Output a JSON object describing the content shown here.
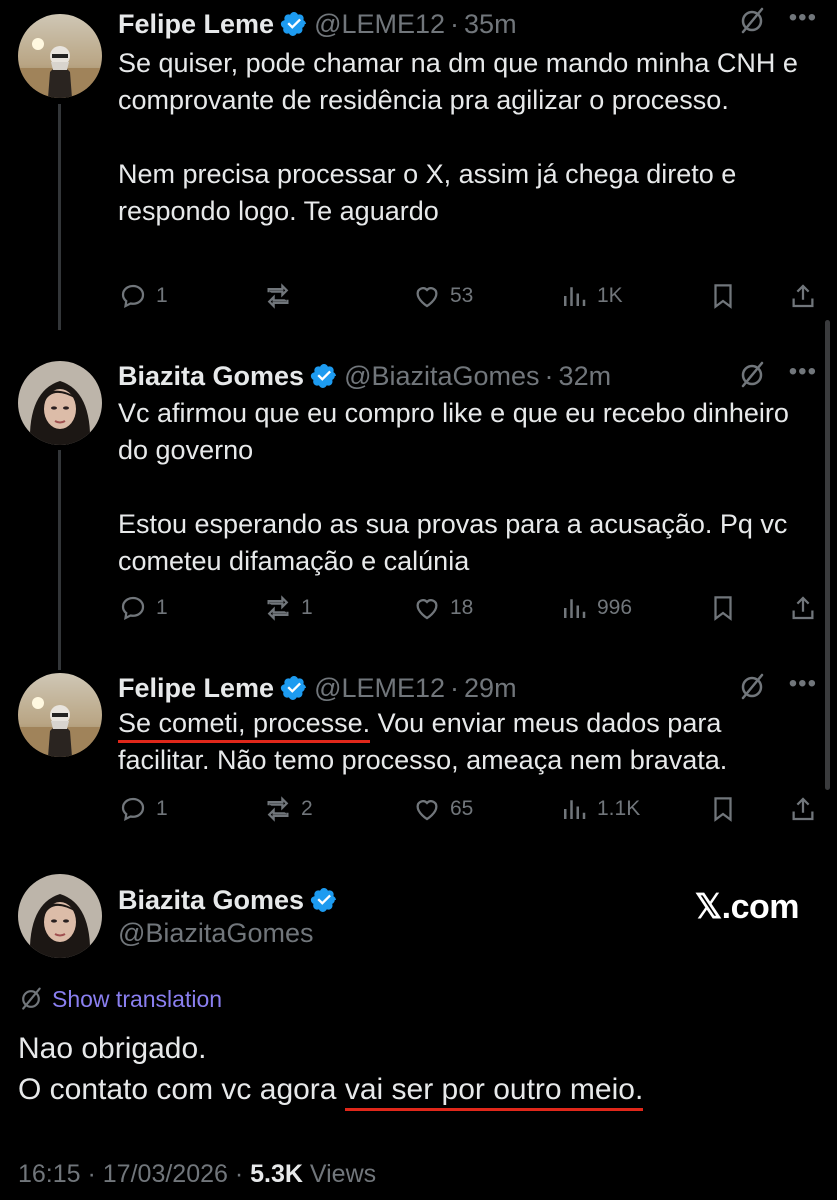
{
  "thread": [
    {
      "name": "Felipe Leme",
      "handle": "@LEME12",
      "time": "35m",
      "paragraphs": [
        "Se quiser, pode chamar na dm que mando minha CNH e comprovante de residência pra agilizar o processo.",
        "Nem precisa processar o X, assim já chega direto e respondo logo. Te aguardo"
      ],
      "replies": "1",
      "reposts": "",
      "likes": "53",
      "views": "1K"
    },
    {
      "name": "Biazita Gomes",
      "handle": "@BiazitaGomes",
      "time": "32m",
      "paragraphs": [
        "Vc afirmou que eu compro like e que eu recebo dinheiro do governo",
        "Estou esperando as sua provas para a acusação. Pq vc cometeu difamação e calúnia"
      ],
      "replies": "1",
      "reposts": "1",
      "likes": "18",
      "views": "996"
    },
    {
      "name": "Felipe Leme",
      "handle": "@LEME12",
      "time": "29m",
      "highlight": "Se cometi, processe.",
      "rest": " Vou enviar meus dados para facilitar. Não temo processo, ameaça nem bravata.",
      "replies": "1",
      "reposts": "2",
      "likes": "65",
      "views": "1.1K"
    }
  ],
  "main": {
    "name": "Biazita Gomes",
    "handle": "@BiazitaGomes",
    "watermark": "𝕏.com",
    "translate_label": "Show translation",
    "line1": "Nao obrigado.",
    "line2_plain": "O contato com vc agora ",
    "line2_highlight": "vai ser por outro meio.",
    "time": "16:15",
    "date": "17/03/2026",
    "views_count": "5.3K",
    "views_label": "Views"
  },
  "icons": [
    "verified-badge-icon",
    "grok-icon",
    "more-icon",
    "reply-icon",
    "repost-icon",
    "like-icon",
    "views-icon",
    "bookmark-icon",
    "share-icon",
    "translate-icon"
  ],
  "colors": {
    "background": "#000000",
    "text": "#e7e9ea",
    "muted": "#71767b",
    "link": "#8a7ff0",
    "verified": "#1d9bf0",
    "annotation": "#e0271a"
  }
}
